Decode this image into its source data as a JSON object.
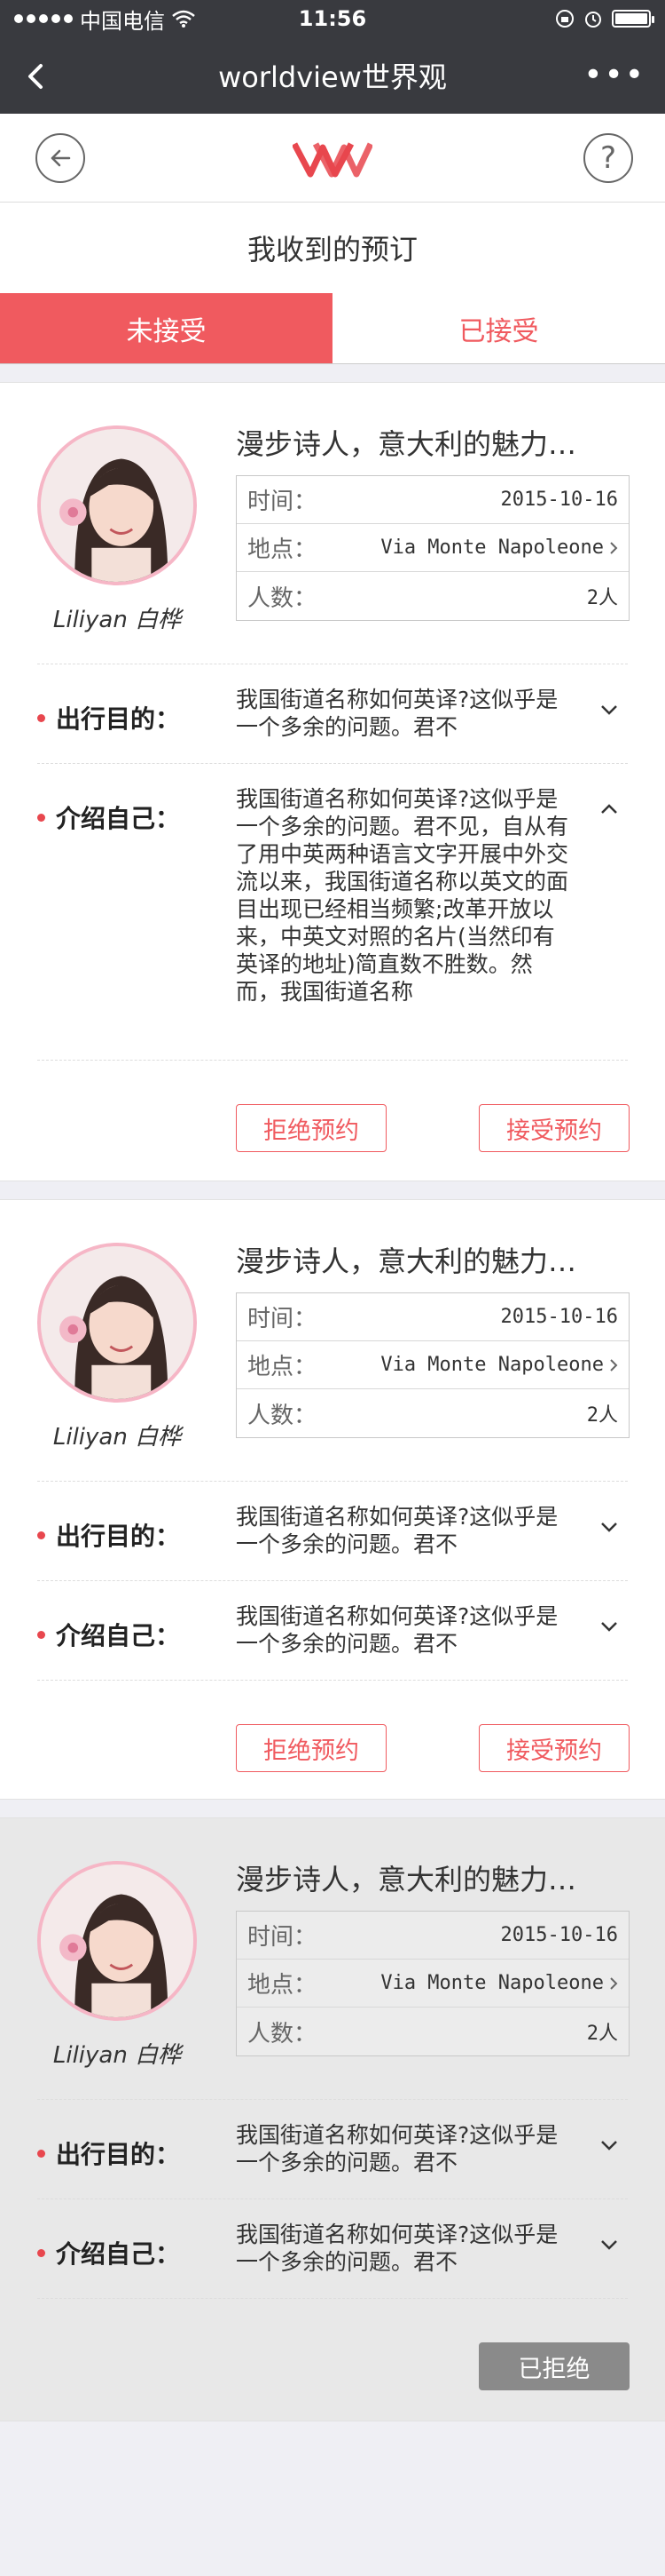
{
  "status_bar": {
    "carrier": "中国电信",
    "time": "11:56"
  },
  "wechat": {
    "title": "worldview世界观",
    "more": "•••"
  },
  "header": {
    "help_symbol": "?",
    "page_title": "我收到的预订"
  },
  "tabs": [
    {
      "label": "未接受",
      "active": true
    },
    {
      "label": "已接受",
      "active": false
    }
  ],
  "labels": {
    "time": "时间：",
    "place": "地点：",
    "people": "人数：",
    "purpose": "出行目的：",
    "intro": "介绍自己："
  },
  "orders": [
    {
      "user_name": "Liliyan 白桦",
      "title": "漫步诗人，意大利的魅力…",
      "time": "2015-10-16",
      "place": "Via Monte Napoleone",
      "people": "2人",
      "purpose": "我国街道名称如何英译?这似乎是一个多余的问题。君不",
      "intro": "我国街道名称如何英译?这似乎是一个多余的问题。君不见，自从有了用中英两种语言文字开展中外交流以来，我国街道名称以英文的面目出现已经相当频繁;改革开放以来，中英文对照的名片(当然印有英译的地址)简直数不胜数。然而，我国街道名称",
      "intro_expanded": true,
      "reject_label": "拒绝预约",
      "accept_label": "接受预约"
    },
    {
      "user_name": "Liliyan 白桦",
      "title": "漫步诗人，意大利的魅力…",
      "time": "2015-10-16",
      "place": "Via Monte Napoleone",
      "people": "2人",
      "purpose": "我国街道名称如何英译?这似乎是一个多余的问题。君不",
      "intro": "我国街道名称如何英译?这似乎是一个多余的问题。君不",
      "intro_expanded": false,
      "reject_label": "拒绝预约",
      "accept_label": "接受预约"
    },
    {
      "user_name": "Liliyan 白桦",
      "title": "漫步诗人，意大利的魅力…",
      "time": "2015-10-16",
      "place": "Via Monte Napoleone",
      "people": "2人",
      "purpose": "我国街道名称如何英译?这似乎是一个多余的问题。君不",
      "intro": "我国街道名称如何英译?这似乎是一个多余的问题。君不",
      "intro_expanded": false,
      "status_label": "已拒绝"
    }
  ],
  "colors": {
    "accent": "#f05a5f",
    "nav_bg": "#393a3f",
    "page_bg": "#efeff4"
  }
}
